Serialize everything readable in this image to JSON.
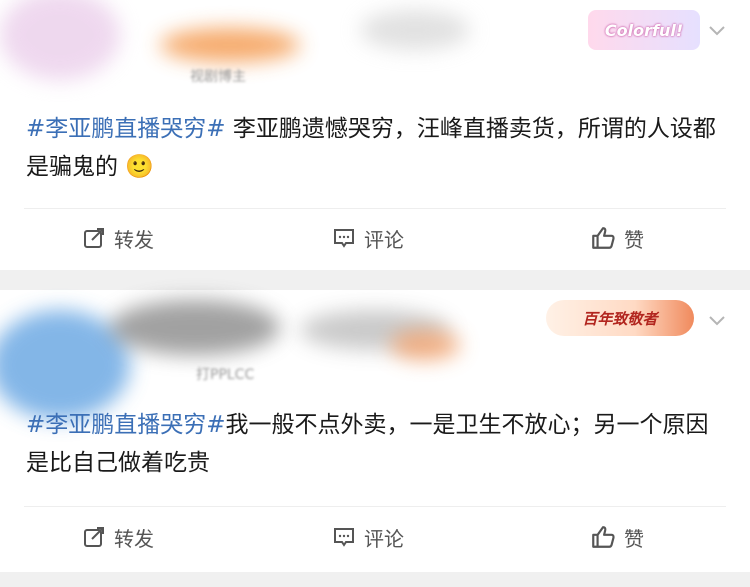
{
  "post_1": {
    "blurred_author_note": "视剧博主",
    "badge": "Colorful!",
    "hashtag": "#李亚鹏直播哭穷#",
    "text": "李亚鹏遗憾哭穷，汪峰直播卖货，所谓的人设都是骗鬼的",
    "emoji": "🙂",
    "actions": {
      "repost": "转发",
      "comment": "评论",
      "like": "赞"
    }
  },
  "post_2": {
    "blurred_author_note": "打PPLCC",
    "badge": "百年致敬者",
    "hashtag": "#李亚鹏直播哭穷#",
    "text": "我一般不点外卖，一是卫生不放心；另一个原因是比自己做着吃贵",
    "actions": {
      "repost": "转发",
      "comment": "评论",
      "like": "赞"
    }
  },
  "colors": {
    "hashtag": "#3b6fb6",
    "text": "#1a1a1a",
    "action": "#555555",
    "background": "#efefef"
  },
  "icons": [
    "repost-icon",
    "comment-icon",
    "like-icon",
    "chevron-down-icon"
  ]
}
